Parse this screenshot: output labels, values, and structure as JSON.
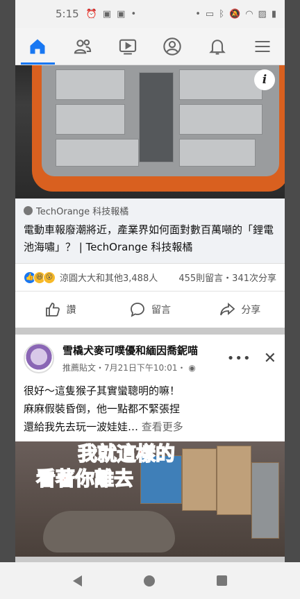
{
  "status_bar": {
    "time": "5:15",
    "left_icons": [
      "alarm-icon",
      "android-icon",
      "android-icon",
      "dot-icon"
    ],
    "right_icons": [
      "dot-icon",
      "cast-icon",
      "bluetooth-icon",
      "mute-icon",
      "wifi-icon",
      "no-sim-icon",
      "battery-icon"
    ]
  },
  "nav": {
    "tabs": [
      {
        "name": "home",
        "icon": "home-icon",
        "active": true
      },
      {
        "name": "friends",
        "icon": "friends-icon",
        "active": false
      },
      {
        "name": "watch",
        "icon": "video-icon",
        "active": false
      },
      {
        "name": "profile",
        "icon": "profile-icon",
        "active": false
      },
      {
        "name": "notifications",
        "icon": "bell-icon",
        "active": false
      },
      {
        "name": "menu",
        "icon": "menu-icon",
        "active": false
      }
    ],
    "accent": "#1877f2"
  },
  "ad_post": {
    "info_glyph": "i",
    "source": "TechOrange 科技報橘",
    "headline": "電動車報廢潮將近，產業界如何面對數百萬噸的「鋰電池海嘯」？ | TechOrange 科技報橘",
    "reactors": "涼圓大大和其他3,488人",
    "counts": "455則留言・341次分享",
    "actions": {
      "like": "讚",
      "comment": "留言",
      "share": "分享"
    }
  },
  "group_post": {
    "name": "雪橇犬麥可噗優和緬因喬鈮喵",
    "meta": "推薦貼文・7月21日下午10:01・",
    "more_label": "•••",
    "close_label": "✕",
    "text_lines": [
      "很好～這隻猴子其實蠻聰明的嘛！",
      "麻麻假裝昏倒，他一點都不緊張捏",
      "還給我先去玩一波娃娃…"
    ],
    "see_more": "查看更多",
    "photo_caption": [
      "我就這樣的",
      "看著你離去"
    ]
  }
}
